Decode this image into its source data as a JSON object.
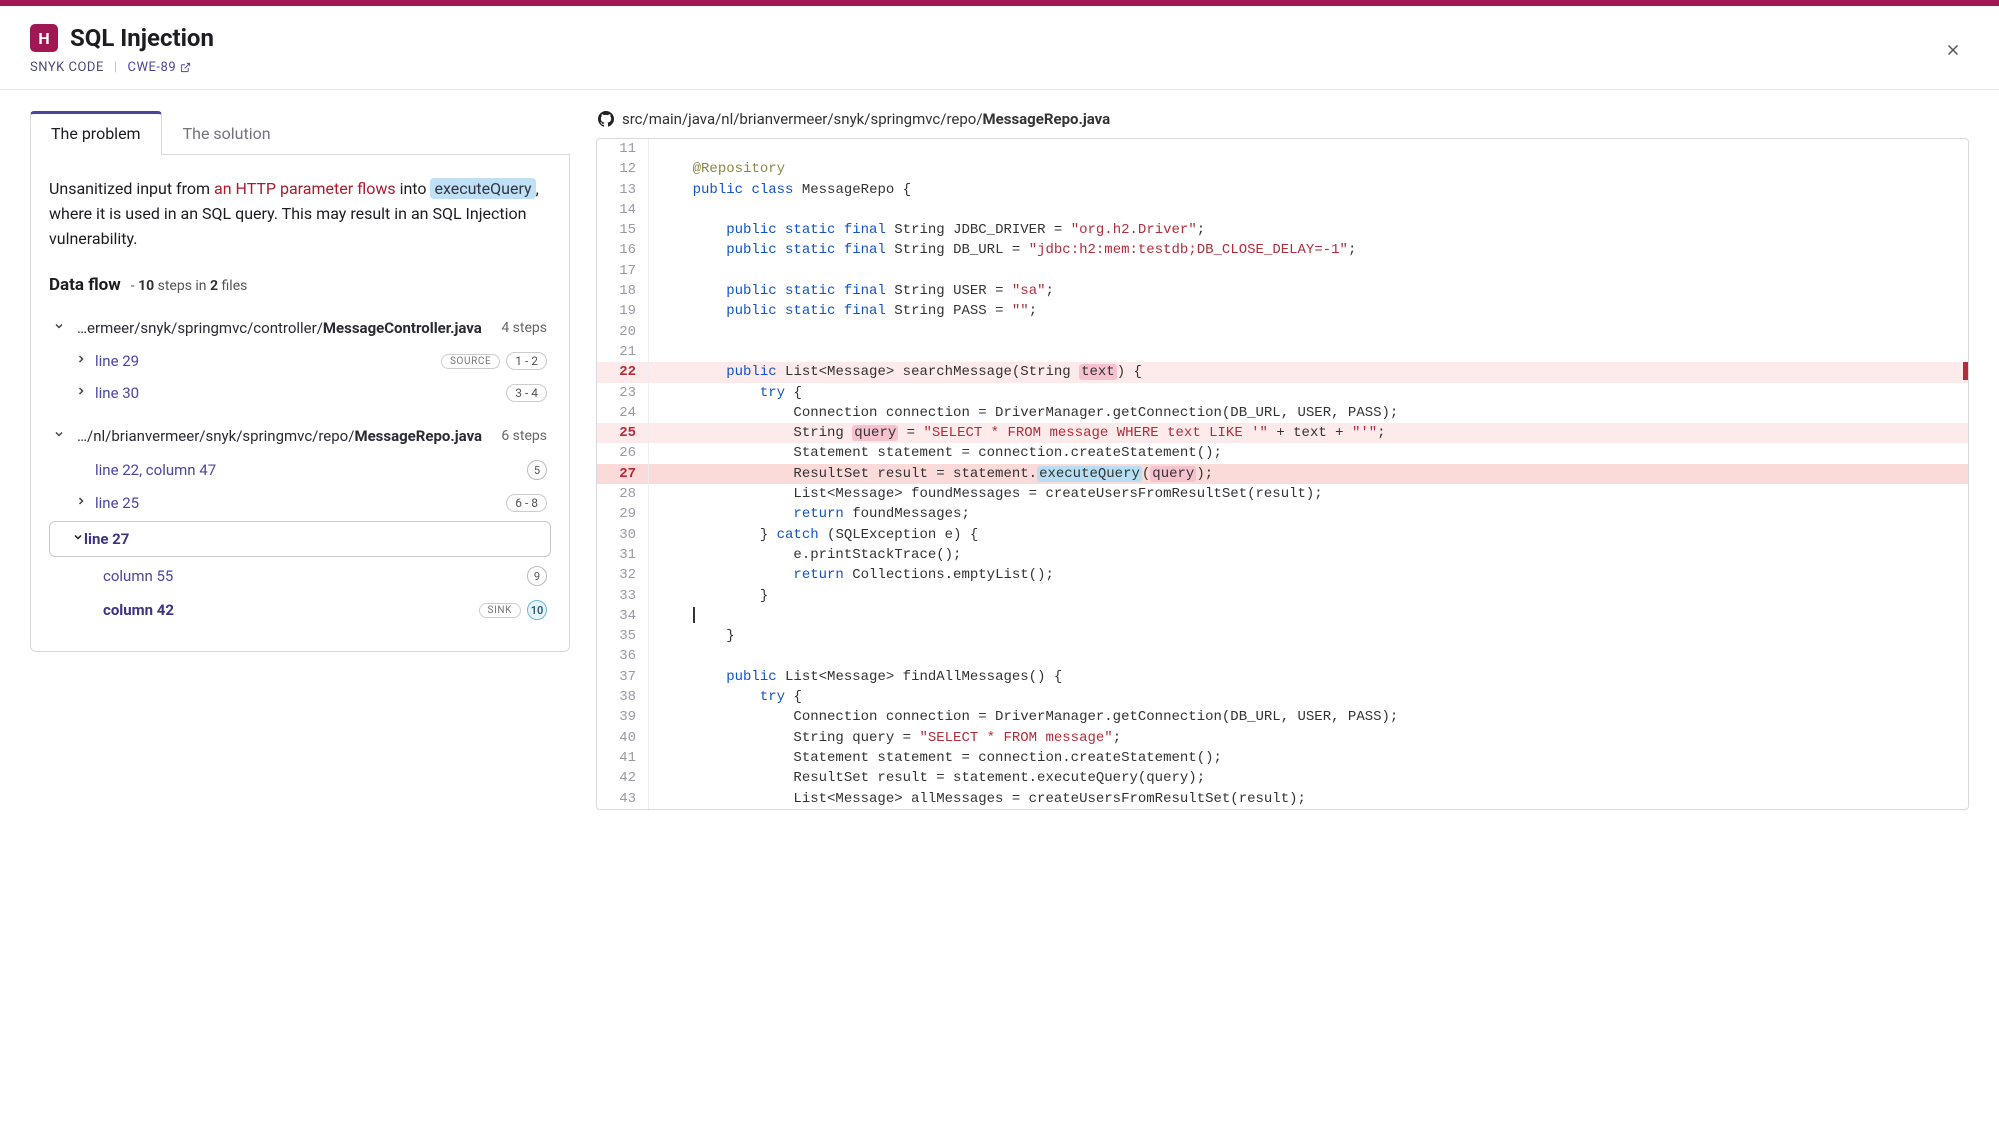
{
  "header": {
    "severity_letter": "H",
    "title": "SQL Injection",
    "source": "SNYK CODE",
    "cwe": "CWE-89"
  },
  "tabs": {
    "problem": "The problem",
    "solution": "The solution"
  },
  "description": {
    "pre": "Unsanitized input from ",
    "source_link": "an HTTP parameter flows",
    "mid": " into ",
    "sink_hl": "executeQuery",
    "post": ", where it is used in an SQL query. This may result in an SQL Injection vulnerability."
  },
  "dataflow": {
    "title": "Data flow",
    "steps_total": "10",
    "steps_text": " steps in ",
    "files_total": "2",
    "files_text": " files",
    "file1": {
      "path_prefix": "…ermeer/snyk/springmvc/controller/",
      "path_file": "MessageController.java",
      "count": "4 steps",
      "line29": "line 29",
      "line29_badge_source": "SOURCE",
      "line29_steps": "1 - 2",
      "line30": "line 30",
      "line30_steps": "3 - 4"
    },
    "file2": {
      "path_prefix": "…/nl/brianvermeer/snyk/springmvc/repo/",
      "path_file": "MessageRepo.java",
      "count": "6 steps",
      "l22": "line 22, column 47",
      "l22_step": "5",
      "l25": "line 25",
      "l25_steps": "6 - 8",
      "l27": "line 27",
      "l27_c55": "column 55",
      "l27_c55_step": "9",
      "l27_c42": "column 42",
      "l27_c42_badge": "SINK",
      "l27_c42_step": "10"
    }
  },
  "code": {
    "path_prefix": "src/main/java/nl/brianvermeer/snyk/springmvc/repo/",
    "path_file": "MessageRepo.java",
    "lines": [
      {
        "n": 11,
        "hl": "",
        "html": ""
      },
      {
        "n": 12,
        "hl": "",
        "html": "    <span class='tok-ann'>@Repository</span>"
      },
      {
        "n": 13,
        "hl": "",
        "html": "    <span class='tok-kw'>public</span> <span class='tok-kw'>class</span> MessageRepo {"
      },
      {
        "n": 14,
        "hl": "",
        "html": ""
      },
      {
        "n": 15,
        "hl": "",
        "html": "        <span class='tok-kw'>public static final</span> String JDBC_DRIVER = <span class='tok-str'>\"org.h2.Driver\"</span>;"
      },
      {
        "n": 16,
        "hl": "",
        "html": "        <span class='tok-kw'>public static final</span> String DB_URL = <span class='tok-str'>\"jdbc:h2:mem:testdb;DB_CLOSE_DELAY=-1\"</span>;"
      },
      {
        "n": 17,
        "hl": "",
        "html": ""
      },
      {
        "n": 18,
        "hl": "",
        "html": "        <span class='tok-kw'>public static final</span> String USER = <span class='tok-str'>\"sa\"</span>;"
      },
      {
        "n": 19,
        "hl": "",
        "html": "        <span class='tok-kw'>public static final</span> String PASS = <span class='tok-str'>\"\"</span>;"
      },
      {
        "n": 20,
        "hl": "",
        "html": ""
      },
      {
        "n": 21,
        "hl": "",
        "html": ""
      },
      {
        "n": 22,
        "hl": "hl-red",
        "html": "        <span class='tok-kw'>public</span> List&lt;Message&gt; searchMessage(String <span class='tok-hl-pink'>text</span>) {",
        "marker": true
      },
      {
        "n": 23,
        "hl": "",
        "html": "            <span class='tok-kw'>try</span> {"
      },
      {
        "n": 24,
        "hl": "",
        "html": "                Connection connection = DriverManager.getConnection(DB_URL, USER, PASS);"
      },
      {
        "n": 25,
        "hl": "hl-red",
        "html": "                String <span class='tok-hl-pink'>query</span> = <span class='tok-str'>\"SELECT * FROM message WHERE text LIKE '\"</span> + text + <span class='tok-str'>\"'\"</span>;"
      },
      {
        "n": 26,
        "hl": "",
        "html": "                Statement statement = connection.createStatement();"
      },
      {
        "n": 27,
        "hl": "hl-red-dark",
        "html": "                ResultSet result = statement.<span class='tok-hl-blue'>executeQuery</span>(<span class='tok-hl-pink'>query</span>);"
      },
      {
        "n": 28,
        "hl": "",
        "html": "                List&lt;Message&gt; foundMessages = createUsersFromResultSet(result);"
      },
      {
        "n": 29,
        "hl": "",
        "html": "                <span class='tok-kw'>return</span> foundMessages;"
      },
      {
        "n": 30,
        "hl": "",
        "html": "            } <span class='tok-kw'>catch</span> (SQLException e) {"
      },
      {
        "n": 31,
        "hl": "",
        "html": "                e.printStackTrace();"
      },
      {
        "n": 32,
        "hl": "",
        "html": "                <span class='tok-kw'>return</span> Collections.emptyList();"
      },
      {
        "n": 33,
        "hl": "",
        "html": "            }"
      },
      {
        "n": 34,
        "hl": "",
        "html": "    <span class='cursor-bar'></span>"
      },
      {
        "n": 35,
        "hl": "",
        "html": "        }"
      },
      {
        "n": 36,
        "hl": "",
        "html": ""
      },
      {
        "n": 37,
        "hl": "",
        "html": "        <span class='tok-kw'>public</span> List&lt;Message&gt; findAllMessages() {"
      },
      {
        "n": 38,
        "hl": "",
        "html": "            <span class='tok-kw'>try</span> {"
      },
      {
        "n": 39,
        "hl": "",
        "html": "                Connection connection = DriverManager.getConnection(DB_URL, USER, PASS);"
      },
      {
        "n": 40,
        "hl": "",
        "html": "                String query = <span class='tok-str'>\"SELECT * FROM message\"</span>;"
      },
      {
        "n": 41,
        "hl": "",
        "html": "                Statement statement = connection.createStatement();"
      },
      {
        "n": 42,
        "hl": "",
        "html": "                ResultSet result = statement.executeQuery(query);"
      },
      {
        "n": 43,
        "hl": "",
        "html": "                List&lt;Message&gt; allMessages = createUsersFromResultSet(result);"
      }
    ]
  }
}
